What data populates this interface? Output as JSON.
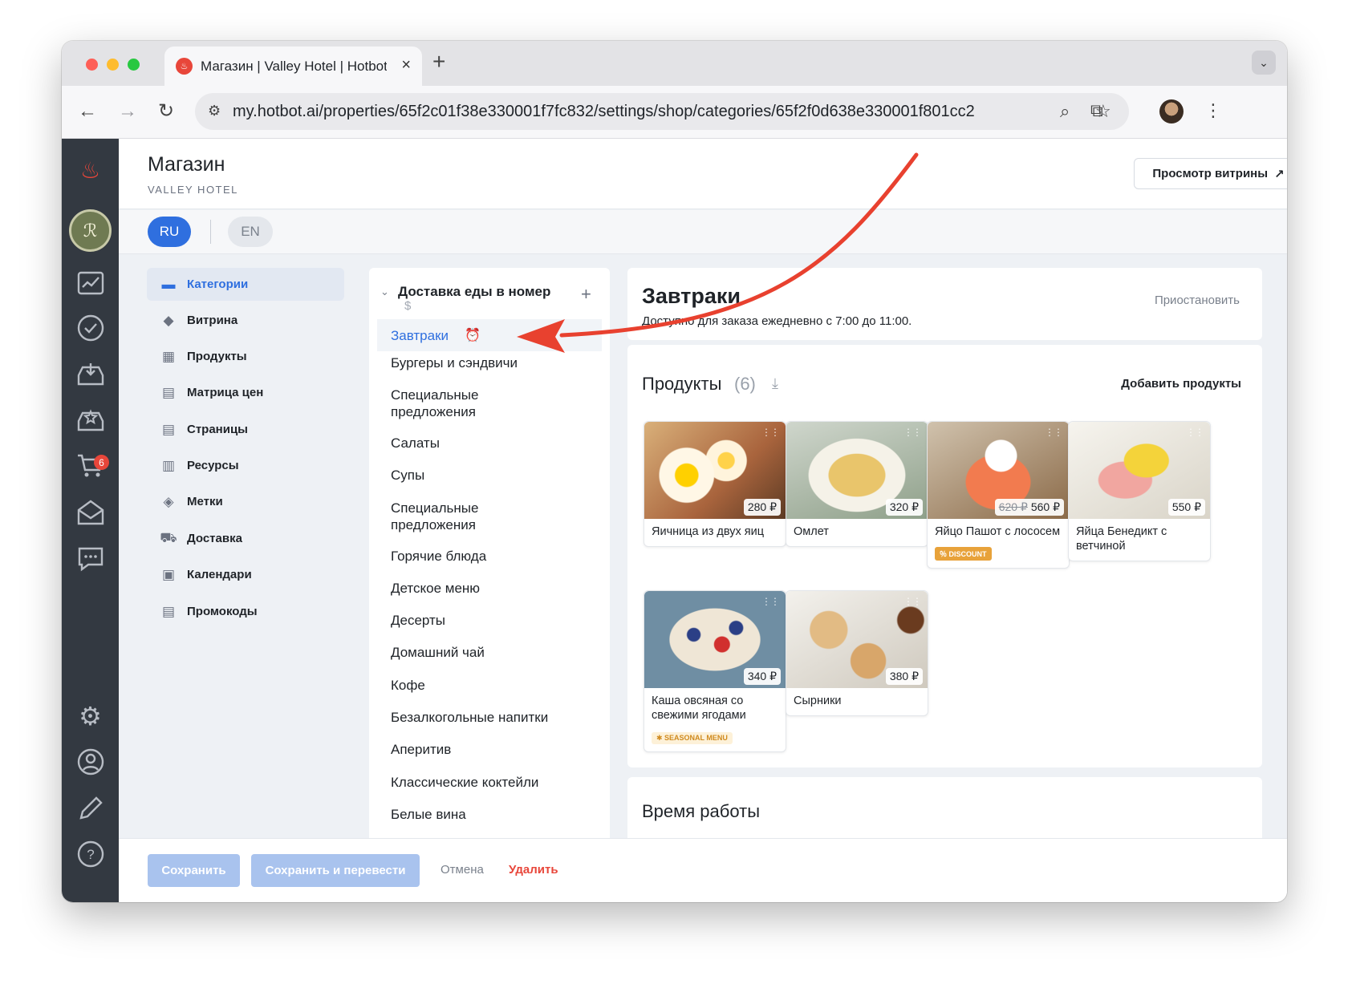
{
  "browser": {
    "tab_title": "Магазин | Valley Hotel | Hotbot",
    "url": "my.hotbot.ai/properties/65f2c01f38e330001f7fc832/settings/shop/categories/65f2f0d638e330001f801cc2"
  },
  "header": {
    "title": "Магазин",
    "subtitle": "VALLEY HOTEL",
    "storefront_button": "Просмотр витрины"
  },
  "languages": {
    "ru": "RU",
    "en": "EN",
    "selected": "RU"
  },
  "rail": {
    "cart_badge": "6",
    "icons": [
      "flame-logo-icon",
      "user-avatar",
      "analytics-icon",
      "tasks-icon",
      "inbox-icon",
      "inbox-star-icon",
      "cart-icon",
      "mail-upload-icon",
      "chat-icon",
      "settings-icon",
      "profile-icon",
      "edit-icon",
      "help-icon"
    ]
  },
  "nav": {
    "items": [
      {
        "label": "Категории",
        "icon": "category-icon",
        "active": true
      },
      {
        "label": "Витрина",
        "icon": "storefront-icon",
        "active": false
      },
      {
        "label": "Продукты",
        "icon": "products-icon",
        "active": false
      },
      {
        "label": "Матрица цен",
        "icon": "price-matrix-icon",
        "active": false
      },
      {
        "label": "Страницы",
        "icon": "pages-icon",
        "active": false
      },
      {
        "label": "Ресурсы",
        "icon": "resources-icon",
        "active": false
      },
      {
        "label": "Метки",
        "icon": "tag-icon",
        "active": false
      },
      {
        "label": "Доставка",
        "icon": "truck-icon",
        "active": false
      },
      {
        "label": "Календари",
        "icon": "calendar-icon",
        "active": false
      },
      {
        "label": "Промокоды",
        "icon": "promo-icon",
        "active": false
      }
    ]
  },
  "categories": {
    "group_title": "Доставка еды в номер",
    "group_sub": "$",
    "items": [
      {
        "label": "Завтраки",
        "selected": true
      },
      {
        "label": "Бургеры и сэндвичи"
      },
      {
        "label": "Специальные предложения"
      },
      {
        "label": "Салаты"
      },
      {
        "label": "Супы"
      },
      {
        "label": "Специальные предложения"
      },
      {
        "label": "Горячие блюда"
      },
      {
        "label": "Детское меню"
      },
      {
        "label": "Десерты"
      },
      {
        "label": "Домашний чай"
      },
      {
        "label": "Кофе"
      },
      {
        "label": "Безалкогольные напитки"
      },
      {
        "label": "Аперитив"
      },
      {
        "label": "Классические коктейли"
      },
      {
        "label": "Белые вина"
      }
    ]
  },
  "category_detail": {
    "title": "Завтраки",
    "description": "Доступно для заказа ежедневно с 7:00 до 11:00.",
    "pause_label": "Приостановить"
  },
  "products": {
    "title": "Продукты",
    "count": "(6)",
    "add_label": "Добавить продукты",
    "items": [
      {
        "name": "Яичница из двух яиц",
        "price": "280 ₽",
        "old_price": "",
        "tag": ""
      },
      {
        "name": "Омлет",
        "price": "320 ₽",
        "old_price": "",
        "tag": ""
      },
      {
        "name": "Яйцо Пашот с лососем",
        "price": "560 ₽",
        "old_price": "620 ₽",
        "tag": "DISCOUNT"
      },
      {
        "name": "Яйца Бенедикт с ветчиной",
        "price": "550 ₽",
        "old_price": "",
        "tag": ""
      },
      {
        "name": "Каша овсяная со свежими ягодами",
        "price": "340 ₽",
        "old_price": "",
        "tag": "SEASONAL MENU"
      },
      {
        "name": "Сырники",
        "price": "380 ₽",
        "old_price": "",
        "tag": ""
      }
    ]
  },
  "hours": {
    "title": "Время работы"
  },
  "footer": {
    "save": "Сохранить",
    "save_translate": "Сохранить и перевести",
    "cancel": "Отмена",
    "delete": "Удалить"
  },
  "colors": {
    "accent": "#2f6fdf",
    "danger": "#e8463a",
    "rail": "#333941",
    "annotation": "#e8412f"
  }
}
